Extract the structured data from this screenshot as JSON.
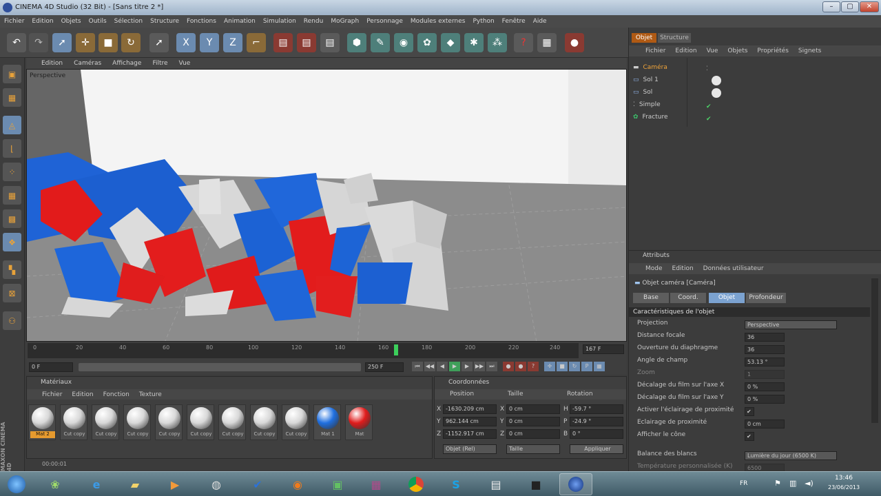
{
  "window": {
    "title": "CINEMA 4D Studio (32 Bit) - [Sans titre 2 *]"
  },
  "menu": [
    "Fichier",
    "Edition",
    "Objets",
    "Outils",
    "Sélection",
    "Structure",
    "Fonctions",
    "Animation",
    "Simulation",
    "Rendu",
    "MoGraph",
    "Personnage",
    "Modules externes",
    "Python",
    "Fenêtre",
    "Aide"
  ],
  "viewport": {
    "menu": [
      "Edition",
      "Caméras",
      "Affichage",
      "Filtre",
      "Vue"
    ],
    "label": "Perspective"
  },
  "timeline": {
    "ticks": [
      "0",
      "20",
      "40",
      "60",
      "80",
      "100",
      "120",
      "140",
      "160",
      "180",
      "200",
      "220",
      "240"
    ],
    "current_frame": "167 F",
    "start": "0 F",
    "end_field": "250 F",
    "range_end": "250 F",
    "time": "00:00:01"
  },
  "materials": {
    "title": "Matériaux",
    "menu": [
      "Fichier",
      "Edition",
      "Fonction",
      "Texture"
    ],
    "items": [
      {
        "label": "Mat 2",
        "color": "#d8d8d8",
        "selected": true
      },
      {
        "label": "Cut copy",
        "color": "#d8d8d8"
      },
      {
        "label": "Cut copy",
        "color": "#d8d8d8"
      },
      {
        "label": "Cut copy",
        "color": "#d8d8d8"
      },
      {
        "label": "Cut copy",
        "color": "#d8d8d8"
      },
      {
        "label": "Cut copy",
        "color": "#d8d8d8"
      },
      {
        "label": "Cut copy",
        "color": "#d8d8d8"
      },
      {
        "label": "Cut copy",
        "color": "#d8d8d8"
      },
      {
        "label": "Cut copy",
        "color": "#d8d8d8"
      },
      {
        "label": "Mat 1",
        "color": "#1f6fe0"
      },
      {
        "label": "Mat",
        "color": "#e01c1c"
      }
    ]
  },
  "coords": {
    "title": "Coordonnées",
    "headers": [
      "Position",
      "Taille",
      "Rotation"
    ],
    "rows": [
      {
        "axis": "X",
        "pos": "-1630.209 cm",
        "size_axis": "X",
        "size": "0 cm",
        "rot_axis": "H",
        "rot": "-59.7 °"
      },
      {
        "axis": "Y",
        "pos": "962.144 cm",
        "size_axis": "Y",
        "size": "0 cm",
        "rot_axis": "P",
        "rot": "-24.9 °"
      },
      {
        "axis": "Z",
        "pos": "-1152.917 cm",
        "size_axis": "Z",
        "size": "0 cm",
        "rot_axis": "B",
        "rot": "0 °"
      }
    ],
    "mode": "Objet (Rel)",
    "size_mode": "Taille",
    "apply": "Appliquer"
  },
  "objects": {
    "tabs": [
      "Objet",
      "Structure"
    ],
    "menu": [
      "Fichier",
      "Edition",
      "Vue",
      "Objets",
      "Propriétés",
      "Signets"
    ],
    "items": [
      {
        "name": "Caméra",
        "active": true
      },
      {
        "name": "Sol 1"
      },
      {
        "name": "Sol"
      },
      {
        "name": "Simple"
      },
      {
        "name": "Fracture"
      }
    ]
  },
  "attributes": {
    "title": "Attributs",
    "menu": [
      "Mode",
      "Edition",
      "Données utilisateur"
    ],
    "object_title": "Objet caméra [Caméra]",
    "tabs": [
      "Base",
      "Coord.",
      "Objet",
      "Profondeur"
    ],
    "active_tab": "Objet",
    "section": "Caractéristiques de l'objet",
    "props": [
      {
        "label": "Projection",
        "value": "Perspective"
      },
      {
        "label": "Distance focale",
        "value": "36"
      },
      {
        "label": "Ouverture du diaphragme",
        "value": "36"
      },
      {
        "label": "Angle de champ",
        "value": "53.13 °"
      },
      {
        "label": "Zoom",
        "value": "1"
      },
      {
        "label": "Décalage du film sur l'axe X",
        "value": "0 %"
      },
      {
        "label": "Décalage du film sur l'axe Y",
        "value": "0 %"
      },
      {
        "label": "Activer l'éclairage de proximité",
        "value": "✔"
      },
      {
        "label": "Eclairage de proximité",
        "value": "0 cm"
      },
      {
        "label": "Afficher le cône",
        "value": "✔"
      },
      {
        "label": "Balance des blancs",
        "value": "Lumière du jour (6500 K)"
      },
      {
        "label": "Température personnalisée (K)",
        "value": "6500"
      }
    ]
  },
  "maxon": "MAXON CINEMA 4D",
  "taskbar": {
    "lang": "FR",
    "time": "13:46",
    "date": "23/06/2013"
  }
}
